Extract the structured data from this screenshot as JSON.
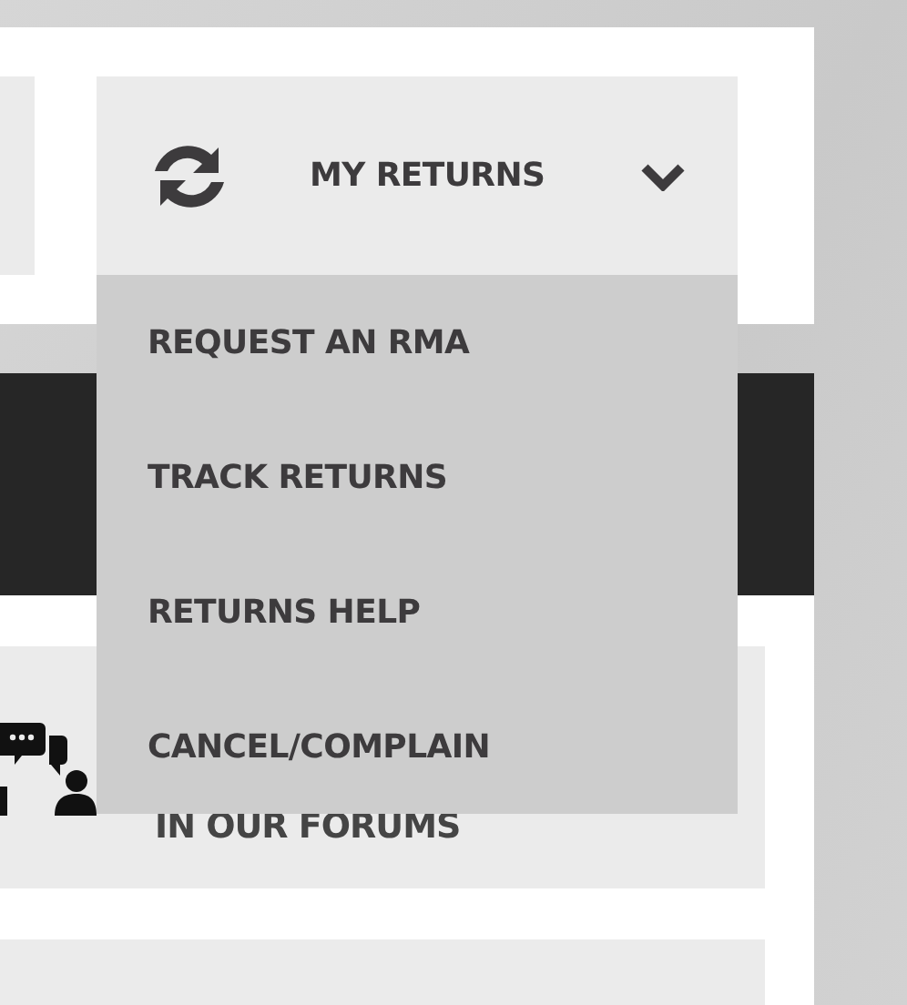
{
  "returns_menu": {
    "label": "MY RETURNS",
    "expanded": true,
    "items": [
      {
        "label": "REQUEST AN RMA"
      },
      {
        "label": "TRACK RETURNS"
      },
      {
        "label": "RETURNS HELP"
      },
      {
        "label": "CANCEL/COMPLAIN"
      }
    ]
  },
  "cards": [
    {
      "text": "IN OUR FORUMS"
    }
  ]
}
